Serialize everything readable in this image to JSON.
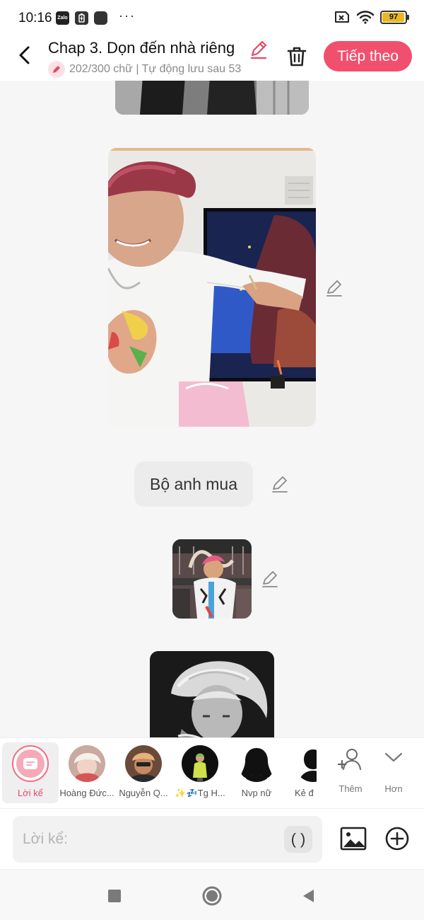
{
  "status_bar": {
    "time": "10:16",
    "app_badge": "Zalo",
    "more_dots": "···",
    "battery": "97",
    "battery_level": 0.97
  },
  "header": {
    "title": "Chap 3. Dọn đến nhà riêng",
    "subtitle": "202/300 chữ | Tự động lưu sau 53",
    "next_label": "Tiếp theo"
  },
  "content": {
    "caption_text": "Bộ anh mua"
  },
  "characters": [
    {
      "label": "Lời kể",
      "selected": true,
      "icon": "narration-icon"
    },
    {
      "label": "Hoàng Đức...",
      "selected": false
    },
    {
      "label": "Nguyễn Q...",
      "selected": false
    },
    {
      "label": "✨💤Tg H...",
      "selected": false
    },
    {
      "label": "Nvp nữ",
      "selected": false
    },
    {
      "label": "Kẻ đ",
      "selected": false
    }
  ],
  "tools": {
    "add_label": "Thêm",
    "more_label": "Hơn"
  },
  "input": {
    "placeholder": "Lời kể:",
    "paren_label": "( )"
  },
  "colors": {
    "accent": "#f0506e",
    "battery": "#e9b81e"
  }
}
